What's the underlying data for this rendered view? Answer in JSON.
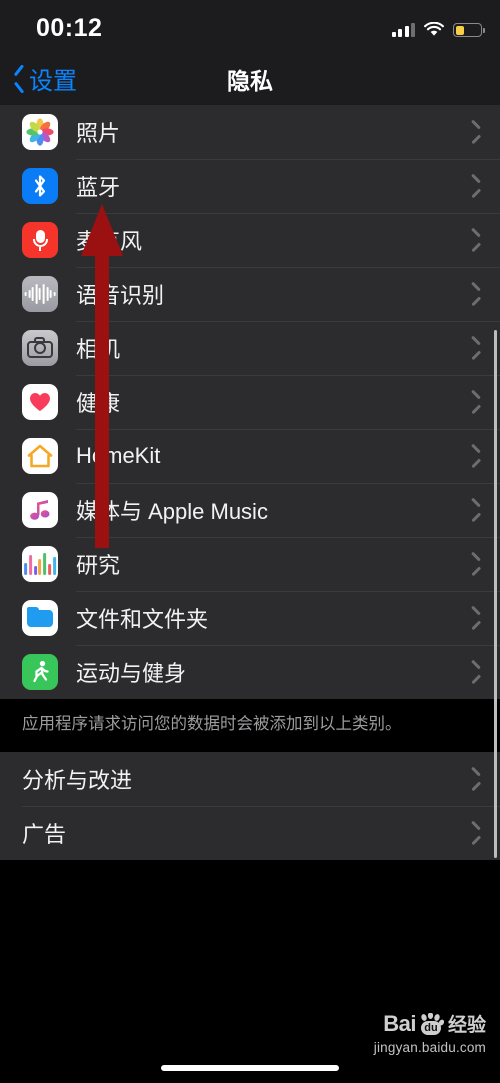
{
  "status_bar": {
    "time": "00:12",
    "signal_icon": "cellular-signal-icon",
    "wifi_icon": "wifi-icon",
    "battery_icon": "battery-low-icon",
    "battery_level_percent": 22
  },
  "nav_bar": {
    "back_label": "设置",
    "back_icon": "chevron-left-icon",
    "title": "隐私"
  },
  "privacy_list": {
    "items": [
      {
        "label": "照片",
        "icon": "photos-app-icon",
        "chevron": "chevron-right-icon"
      },
      {
        "label": "蓝牙",
        "icon": "bluetooth-icon",
        "chevron": "chevron-right-icon"
      },
      {
        "label": "麦克风",
        "icon": "microphone-icon",
        "chevron": "chevron-right-icon"
      },
      {
        "label": "语音识别",
        "icon": "speech-recognition-icon",
        "chevron": "chevron-right-icon"
      },
      {
        "label": "相机",
        "icon": "camera-icon",
        "chevron": "chevron-right-icon"
      },
      {
        "label": "健康",
        "icon": "health-app-icon",
        "chevron": "chevron-right-icon"
      },
      {
        "label": "HomeKit",
        "icon": "homekit-icon",
        "chevron": "chevron-right-icon"
      },
      {
        "label": "媒体与 Apple Music",
        "icon": "apple-music-icon",
        "chevron": "chevron-right-icon"
      },
      {
        "label": "研究",
        "icon": "research-app-icon",
        "chevron": "chevron-right-icon"
      },
      {
        "label": "文件和文件夹",
        "icon": "files-app-icon",
        "chevron": "chevron-right-icon"
      },
      {
        "label": "运动与健身",
        "icon": "fitness-app-icon",
        "chevron": "chevron-right-icon"
      }
    ],
    "footnote": "应用程序请求访问您的数据时会被添加到以上类别。"
  },
  "secondary_list": {
    "items": [
      {
        "label": "分析与改进",
        "chevron": "chevron-right-icon"
      },
      {
        "label": "广告",
        "chevron": "chevron-right-icon"
      }
    ]
  },
  "annotation": {
    "arrow_icon": "red-up-arrow-annotation",
    "color": "#9b1111",
    "points_at": "蓝牙"
  },
  "watermark": {
    "brand": "Bai",
    "paw_label": "du",
    "suffix": "经验",
    "url": "jingyan.baidu.com"
  },
  "home_indicator": "home-indicator-bar",
  "colors": {
    "accent_blue": "#0a84ff",
    "row_background": "#2c2c2e",
    "page_background": "#000000",
    "separator": "#3b3b3d",
    "battery_yellow": "#f7cf46"
  }
}
